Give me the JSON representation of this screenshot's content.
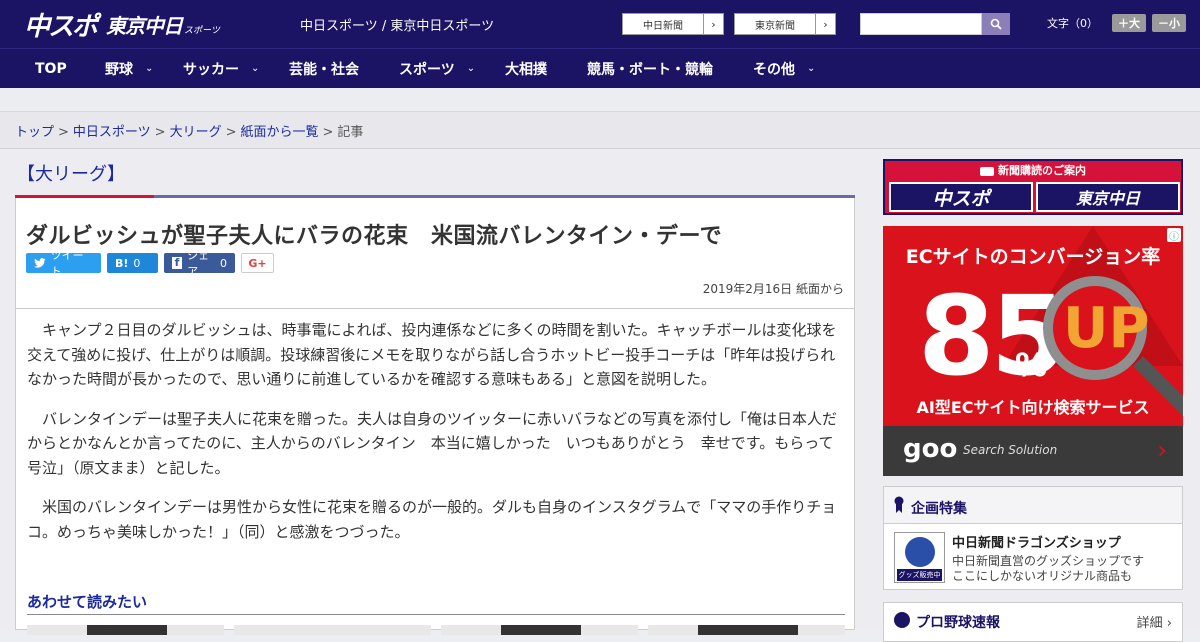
{
  "header": {
    "logo_main": "中スポ",
    "logo_tokyo": "東京中日",
    "logo_sports": "スポーツ",
    "site_title": "中日スポーツ / 東京中日スポーツ",
    "btn_chunichi": "中日新聞",
    "btn_tokyo": "東京新聞",
    "arrow": "›",
    "search_placeholder": "",
    "font_label": "文字（0）",
    "font_plus": "＋大",
    "font_minus": "－小"
  },
  "nav": {
    "items": [
      {
        "label": "TOP",
        "dropdown": false
      },
      {
        "label": "野球",
        "dropdown": true
      },
      {
        "label": "サッカー",
        "dropdown": true
      },
      {
        "label": "芸能・社会",
        "dropdown": false
      },
      {
        "label": "スポーツ",
        "dropdown": true
      },
      {
        "label": "大相撲",
        "dropdown": false
      },
      {
        "label": "競馬・ボート・競輪",
        "dropdown": false
      },
      {
        "label": "その他",
        "dropdown": true
      }
    ],
    "chevron": "⌄"
  },
  "breadcrumb": {
    "items": [
      "トップ",
      "中日スポーツ",
      "大リーグ",
      "紙面から一覧",
      "記事"
    ],
    "sep": ">"
  },
  "category": "【大リーグ】",
  "article": {
    "title": "ダルビッシュが聖子夫人にバラの花束　米国流バレンタイン・デーで",
    "share": {
      "tweet": "ツイート",
      "hatena": "B!",
      "hatena_count": "0",
      "facebook": "シェア",
      "facebook_count": "0",
      "gplus": "G+"
    },
    "date": "2019年2月16日 紙面から",
    "paragraphs": [
      "キャンプ２日目のダルビッシュは、時事電によれば、投内連係などに多くの時間を割いた。キャッチボールは変化球を交えて強めに投げ、仕上がりは順調。投球練習後にメモを取りながら話し合うホットビー投手コーチは「昨年は投げられなかった時間が長かったので、思い通りに前進しているかを確認する意味もある」と意図を説明した。",
      "バレンタインデーは聖子夫人に花束を贈った。夫人は自身のツイッターに赤いバラなどの写真を添付し「俺は日本人だからとかなんとか言ってたのに、主人からのバレンタイン　本当に嬉しかった　いつもありがとう　幸せです。もらって号泣」（原文まま）と記した。",
      "米国のバレンタインデーは男性から女性に花束を贈るのが一般的。ダルも自身のインスタグラムで「ママの手作りチョコ。めっちゃ美味しかった！」（同）と感激をつづった。"
    ],
    "related_heading": "あわせて読みたい"
  },
  "sidebar": {
    "promo": {
      "heading": "新聞購読のご案内",
      "btn1": "中スポ",
      "btn2": "東京中日"
    },
    "ad": {
      "headline": "ECサイトのコンバージョン率",
      "big": "85",
      "pct": "%",
      "up": "UP",
      "sub": "AI型ECサイト向け検索サービス",
      "brand": "goo",
      "brand_sub": "Search Solution",
      "arrow": "›",
      "info": "ⓘ"
    },
    "feature": {
      "heading": "企画特集",
      "item_title": "中日新聞ドラゴンズショップ",
      "item_desc1": "中日新聞直営のグッズショップです",
      "item_desc2": "ここにしかないオリジナル商品も",
      "img_label": "グッズ販売中"
    },
    "baseball": {
      "heading": "プロ野球速報",
      "more": "詳細 ›"
    }
  },
  "colors": {
    "brand_navy": "#1b1464",
    "accent_red": "#d6123a",
    "link_blue": "#1b2a9c"
  }
}
